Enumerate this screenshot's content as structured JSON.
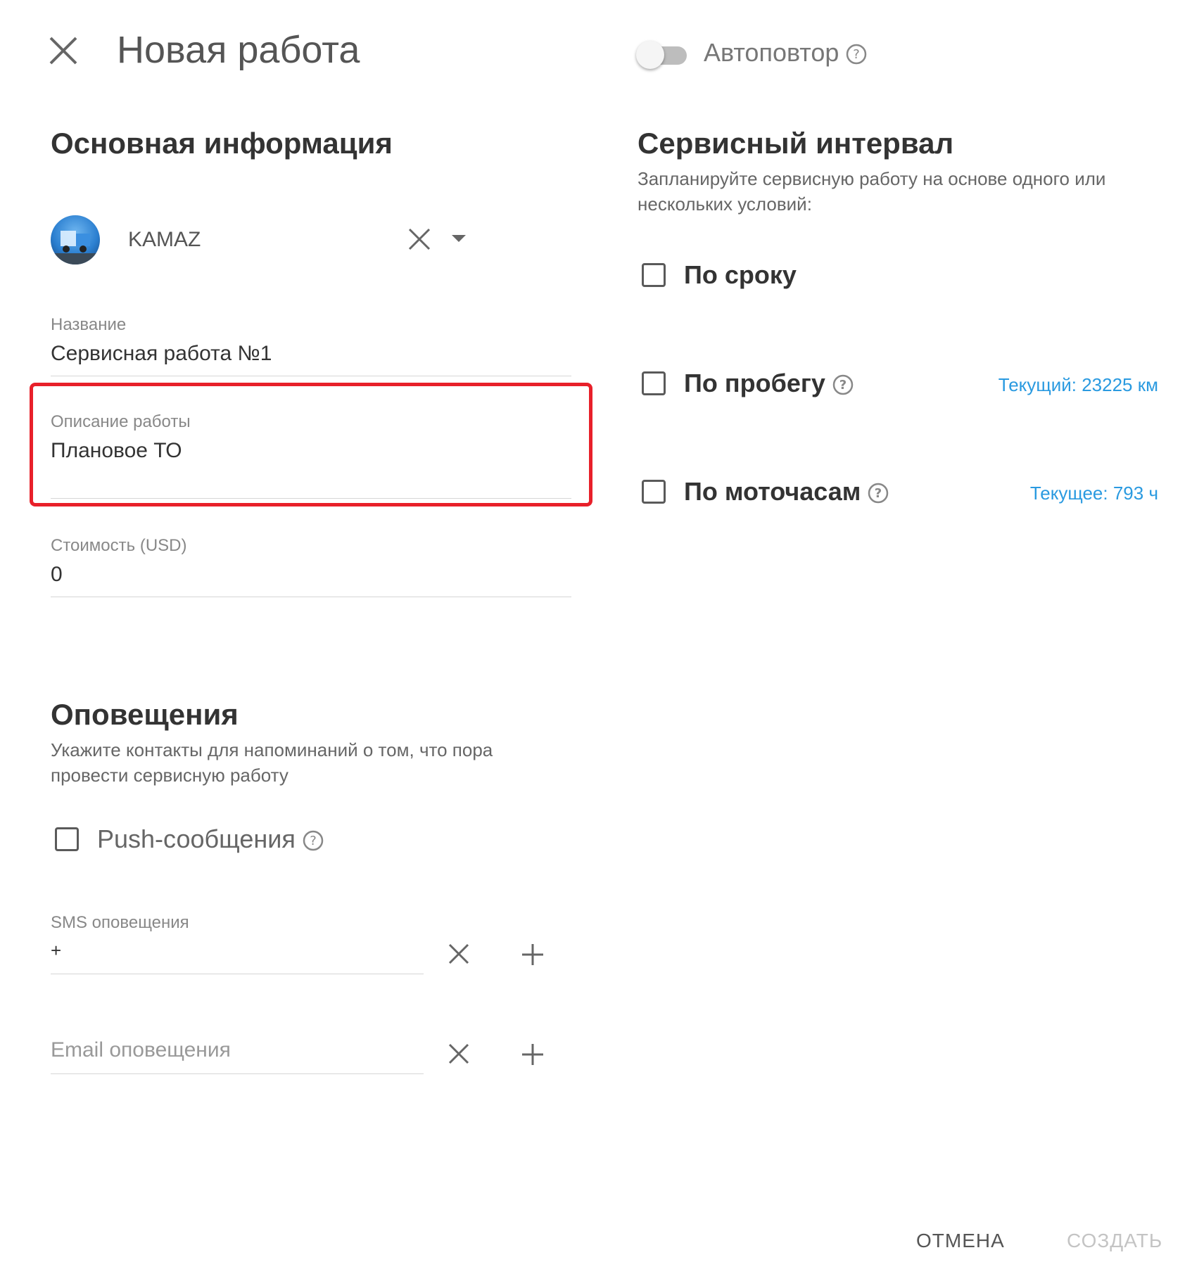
{
  "header": {
    "title": "Новая работа",
    "autorepeat_label": "Автоповтор",
    "autorepeat_on": false
  },
  "main_info": {
    "heading": "Основная информация",
    "vehicle": {
      "name": "KAMAZ"
    },
    "name_field": {
      "label": "Название",
      "value": "Сервисная работа №1"
    },
    "description_field": {
      "label": "Описание работы",
      "value": "Плановое ТО"
    },
    "cost_field": {
      "label": "Стоимость (USD)",
      "value": "0"
    }
  },
  "notifications": {
    "heading": "Оповещения",
    "subtitle_line1": "Укажите контакты для напоминаний о том, что пора",
    "subtitle_line2": "провести сервисную работу",
    "push_label": "Push-сообщения",
    "sms_label": "SMS оповещения",
    "sms_value": "+",
    "email_placeholder": "Email оповещения"
  },
  "service_interval": {
    "heading": "Сервисный интервал",
    "subtitle_line1": "Запланируйте сервисную работу на основе одного или",
    "subtitle_line2": "нескольких условий:",
    "by_term_label": "По сроку",
    "by_mileage_label": "По пробегу",
    "by_mileage_current": "Текущий: 23225 км",
    "by_hours_label": "По моточасам",
    "by_hours_current": "Текущее: 793 ч"
  },
  "footer": {
    "cancel_label": "ОТМЕНА",
    "create_label": "СОЗДАТЬ"
  },
  "colors": {
    "accent_link": "#2a9ae0",
    "highlight": "#e8202a"
  }
}
